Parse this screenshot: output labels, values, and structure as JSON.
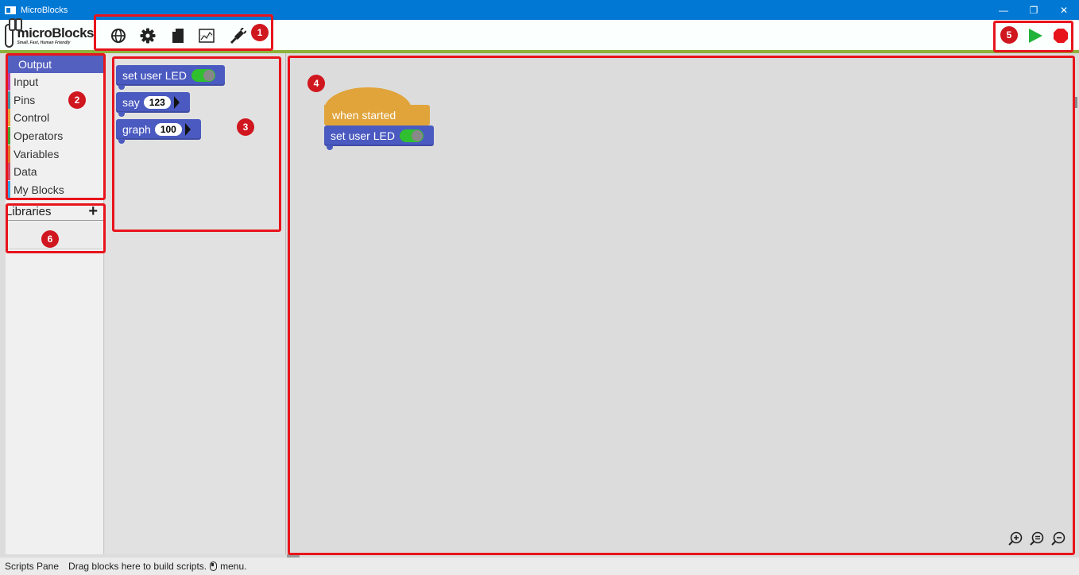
{
  "window": {
    "title": "MicroBlocks",
    "buttons": [
      "—",
      "❐",
      "✕"
    ]
  },
  "logo": {
    "name": "microBlocks",
    "tagline": "Small, Fast, Human Friendly"
  },
  "toolbar": {
    "icons": [
      "globe-icon",
      "gear-icon",
      "file-icon",
      "graph-icon",
      "connect-icon"
    ],
    "run_color": "#22b33b",
    "stop_color": "#e8141c"
  },
  "categories": [
    {
      "label": "Output",
      "color": "#5460bf",
      "selected": true
    },
    {
      "label": "Input",
      "color": "#b43fa7"
    },
    {
      "label": "Pins",
      "color": "#4b8fa0"
    },
    {
      "label": "Control",
      "color": "#e1a43b"
    },
    {
      "label": "Operators",
      "color": "#4ca330"
    },
    {
      "label": "Variables",
      "color": "#d9762b"
    },
    {
      "label": "Data",
      "color": "#cf4b68"
    },
    {
      "label": "My Blocks",
      "color": "#3a9ee0"
    }
  ],
  "libraries": {
    "label": "Libraries",
    "add": "+"
  },
  "palette_blocks": [
    {
      "label": "set user LED"
    },
    {
      "label": "say",
      "slot": "123"
    },
    {
      "label": "graph",
      "slot": "100"
    }
  ],
  "script": {
    "hat_label": "when started",
    "block_label": "set user LED"
  },
  "annotations": [
    "1",
    "2",
    "3",
    "4",
    "5",
    "6"
  ],
  "status": {
    "pane": "Scripts Pane",
    "hint": "Drag blocks here to build scripts.",
    "menu": "menu."
  }
}
